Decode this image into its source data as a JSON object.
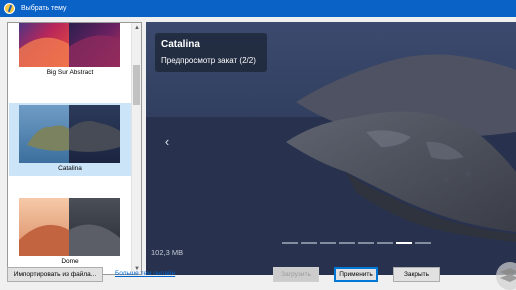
{
  "window": {
    "title": "Выбрать тему"
  },
  "themes": [
    {
      "label": "Big Sur Abstract",
      "selected": false
    },
    {
      "label": "Catalina",
      "selected": true
    },
    {
      "label": "Dome",
      "selected": false
    }
  ],
  "preview": {
    "title": "Catalina",
    "subtitle": "Предпросмотр закат (2/2)",
    "size": "102,3 MB",
    "image_count": 8,
    "active_image": 7
  },
  "buttons": {
    "import": "Импортировать из файла...",
    "more_themes": "Больше тем онлайн",
    "download": "Загрузить",
    "apply": "Применить",
    "close": "Закрыть"
  },
  "colors": {
    "titlebar": "#0a62c7",
    "selection": "#cce4f7",
    "link": "#0066cc",
    "accent": "#0078d7"
  }
}
